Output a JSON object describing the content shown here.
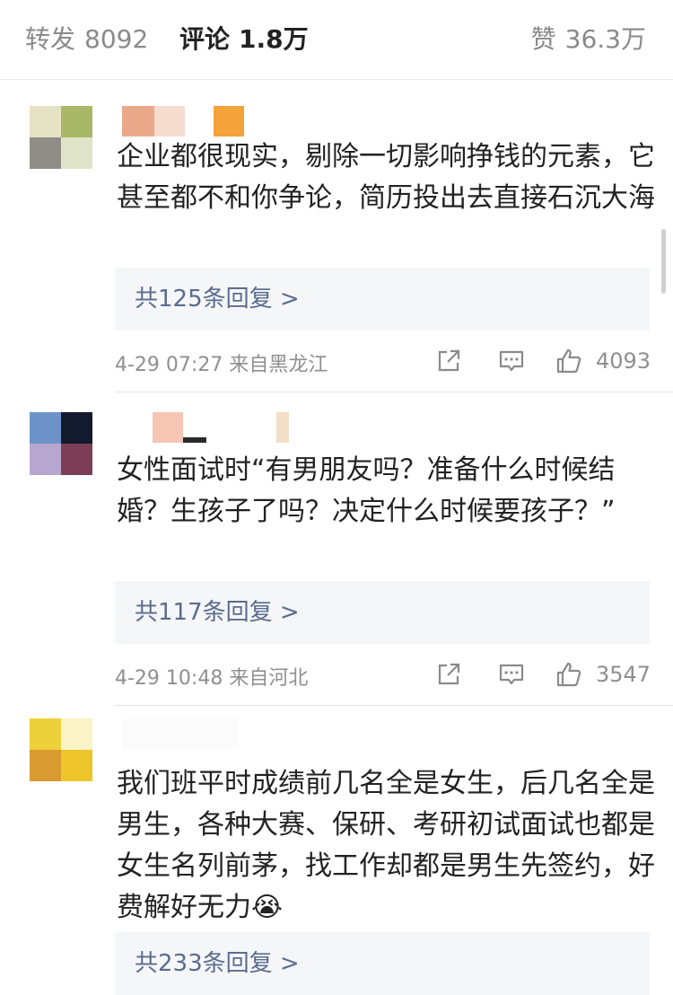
{
  "tabs": {
    "repost_label": "转发",
    "repost_count": "8092",
    "comments_label": "评论",
    "comments_count": "1.8万",
    "likes_label": "赞",
    "likes_count": "36.3万"
  },
  "comments": [
    {
      "content": "企业都很现实，剔除一切影响挣钱的元素，它甚至都不和你争论，简历投出去直接石沉大海",
      "replies": "共125条回复 >",
      "meta": "4-29 07:27  来自黑龙江",
      "likes": "4093"
    },
    {
      "content": "女性面试时“有男朋友吗？准备什么时候结婚？生孩子了吗？决定什么时候要孩子？”",
      "replies": "共117条回复 >",
      "meta": "4-29 10:48  来自河北",
      "likes": "3547"
    },
    {
      "content": "我们班平时成绩前几名全是女生，后几名全是男生，各种大赛、保研、考研初试面试也都是女生名列前茅，找工作却都是男生先签约，好费解好无力",
      "emoji": "😭",
      "replies": "共233条回复 >"
    }
  ],
  "colors": {
    "link": "#5a6c8f",
    "meta": "#8f8f8f",
    "reply_bg": "#f5f6f8"
  },
  "icons": [
    "share-icon",
    "comment-icon",
    "thumbs-up-icon",
    "crying-emoji"
  ]
}
